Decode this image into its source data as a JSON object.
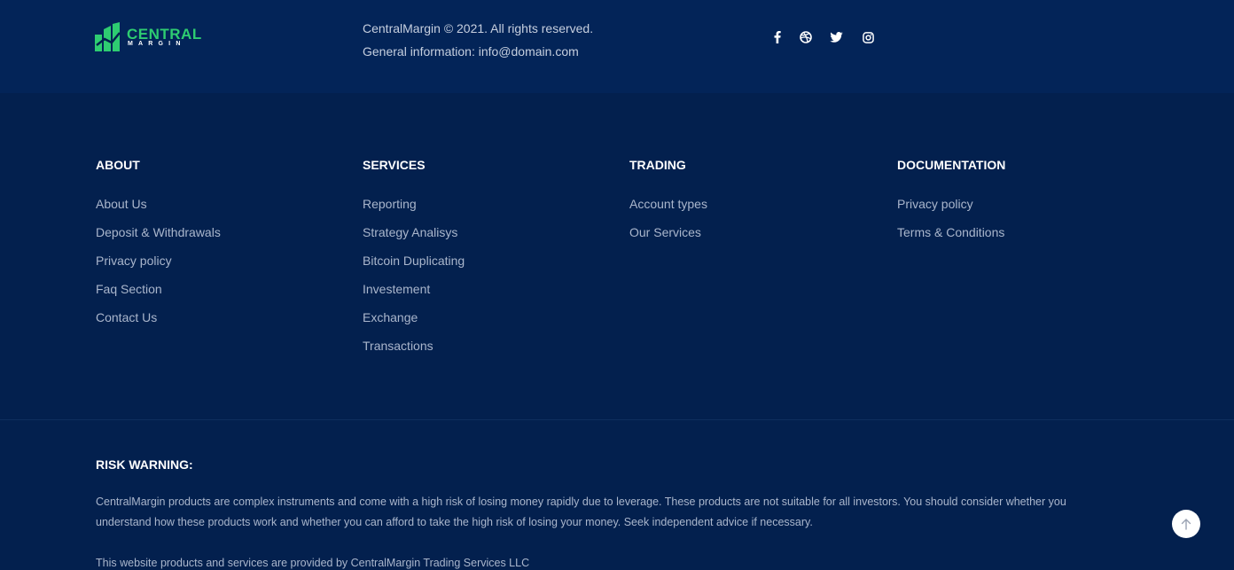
{
  "header": {
    "logo": {
      "word1": "CENTRAL",
      "word2": "MARGIN",
      "brand_color": "#2ecc71"
    },
    "copyright": "CentralMargin © 2021. All rights reserved.",
    "contact": "General information: info@domain.com",
    "social_icons": [
      "facebook-icon",
      "dribbble-icon",
      "twitter-icon",
      "instagram-icon"
    ]
  },
  "columns": [
    {
      "title": "ABOUT",
      "items": [
        "About Us",
        "Deposit & Withdrawals",
        "Privacy policy",
        "Faq Section",
        "Contact Us"
      ]
    },
    {
      "title": "SERVICES",
      "items": [
        "Reporting",
        "Strategy Analisys",
        "Bitcoin Duplicating",
        "Investement",
        "Exchange",
        "Transactions"
      ]
    },
    {
      "title": "TRADING",
      "items": [
        "Account types",
        "Our Services"
      ]
    },
    {
      "title": "DOCUMENTATION",
      "items": [
        "Privacy policy",
        "Terms & Conditions"
      ]
    }
  ],
  "risk": {
    "title": "RISK WARNING:",
    "text": "CentralMargin products are complex instruments and come with a high risk of losing money rapidly due to leverage. These products are not suitable for all investors. You should consider whether you understand how these products work and whether you can afford to take the high risk of losing your money. Seek independent advice if necessary.",
    "provider": "This website products and services are provided by CentralMargin Trading Services LLC"
  },
  "colors": {
    "background": "#03204e",
    "topbar": "#032458",
    "accent": "#2ecc71"
  }
}
